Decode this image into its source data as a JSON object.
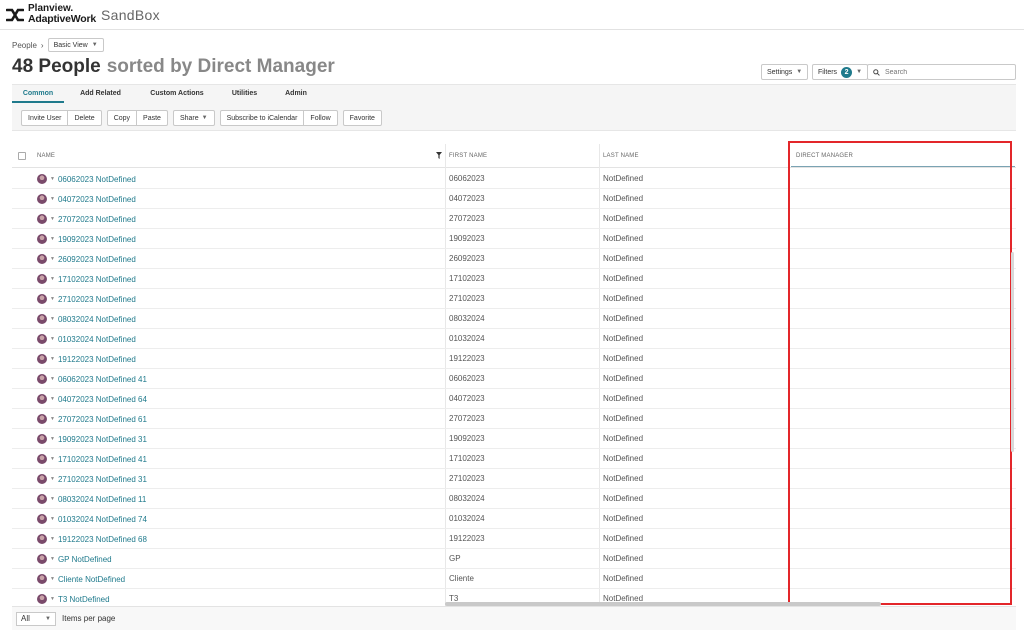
{
  "app": {
    "brand_line1": "Planview.",
    "brand_line2": "AdaptiveWork",
    "environment": "SandBox"
  },
  "breadcrumb": {
    "root": "People",
    "separator": "›",
    "view": "Basic View"
  },
  "title": {
    "count_label": "48 People",
    "sorted_label": "sorted by",
    "sort_field": "Direct Manager"
  },
  "toolbar": {
    "settings_label": "Settings",
    "filters_label": "Filters",
    "filters_count": "2",
    "search_placeholder": "Search"
  },
  "tabs": [
    {
      "label": "Common",
      "active": true
    },
    {
      "label": "Add Related",
      "active": false
    },
    {
      "label": "Custom Actions",
      "active": false
    },
    {
      "label": "Utilities",
      "active": false
    },
    {
      "label": "Admin",
      "active": false
    }
  ],
  "actions": {
    "invite_user": "Invite User",
    "delete": "Delete",
    "copy": "Copy",
    "paste": "Paste",
    "share": "Share",
    "subscribe": "Subscribe to iCalendar",
    "follow": "Follow",
    "favorite": "Favorite"
  },
  "grid": {
    "columns": [
      "NAME",
      "FIRST NAME",
      "LAST NAME",
      "DIRECT MANAGER"
    ],
    "rows": [
      {
        "name": "06062023 NotDefined",
        "first_name": "06062023",
        "last_name": "NotDefined",
        "direct_manager": ""
      },
      {
        "name": "04072023 NotDefined",
        "first_name": "04072023",
        "last_name": "NotDefined",
        "direct_manager": ""
      },
      {
        "name": "27072023 NotDefined",
        "first_name": "27072023",
        "last_name": "NotDefined",
        "direct_manager": ""
      },
      {
        "name": "19092023 NotDefined",
        "first_name": "19092023",
        "last_name": "NotDefined",
        "direct_manager": ""
      },
      {
        "name": "26092023 NotDefined",
        "first_name": "26092023",
        "last_name": "NotDefined",
        "direct_manager": ""
      },
      {
        "name": "17102023 NotDefined",
        "first_name": "17102023",
        "last_name": "NotDefined",
        "direct_manager": ""
      },
      {
        "name": "27102023 NotDefined",
        "first_name": "27102023",
        "last_name": "NotDefined",
        "direct_manager": ""
      },
      {
        "name": "08032024 NotDefined",
        "first_name": "08032024",
        "last_name": "NotDefined",
        "direct_manager": ""
      },
      {
        "name": "01032024 NotDefined",
        "first_name": "01032024",
        "last_name": "NotDefined",
        "direct_manager": ""
      },
      {
        "name": "19122023 NotDefined",
        "first_name": "19122023",
        "last_name": "NotDefined",
        "direct_manager": ""
      },
      {
        "name": "06062023 NotDefined 41",
        "first_name": "06062023",
        "last_name": "NotDefined",
        "direct_manager": ""
      },
      {
        "name": "04072023 NotDefined 64",
        "first_name": "04072023",
        "last_name": "NotDefined",
        "direct_manager": ""
      },
      {
        "name": "27072023 NotDefined 61",
        "first_name": "27072023",
        "last_name": "NotDefined",
        "direct_manager": ""
      },
      {
        "name": "19092023 NotDefined 31",
        "first_name": "19092023",
        "last_name": "NotDefined",
        "direct_manager": ""
      },
      {
        "name": "17102023 NotDefined 41",
        "first_name": "17102023",
        "last_name": "NotDefined",
        "direct_manager": ""
      },
      {
        "name": "27102023 NotDefined 31",
        "first_name": "27102023",
        "last_name": "NotDefined",
        "direct_manager": ""
      },
      {
        "name": "08032024 NotDefined 11",
        "first_name": "08032024",
        "last_name": "NotDefined",
        "direct_manager": ""
      },
      {
        "name": "01032024 NotDefined 74",
        "first_name": "01032024",
        "last_name": "NotDefined",
        "direct_manager": ""
      },
      {
        "name": "19122023 NotDefined 68",
        "first_name": "19122023",
        "last_name": "NotDefined",
        "direct_manager": ""
      },
      {
        "name": "GP NotDefined",
        "first_name": "GP",
        "last_name": "NotDefined",
        "direct_manager": ""
      },
      {
        "name": "Cliente NotDefined",
        "first_name": "Cliente",
        "last_name": "NotDefined",
        "direct_manager": ""
      },
      {
        "name": "T3 NotDefined",
        "first_name": "T3",
        "last_name": "NotDefined",
        "direct_manager": ""
      }
    ]
  },
  "footer": {
    "per_page_value": "All",
    "per_page_label": "Items per page"
  },
  "colors": {
    "accent": "#1f7a8c",
    "highlight": "#e3262a",
    "ribbon_bg": "#f5f5f5"
  },
  "icons": {
    "logo": "planview-logo-icon",
    "search": "search-icon",
    "filter": "filter-icon",
    "avatar": "user-avatar-icon",
    "dropdown": "chevron-down-icon"
  }
}
